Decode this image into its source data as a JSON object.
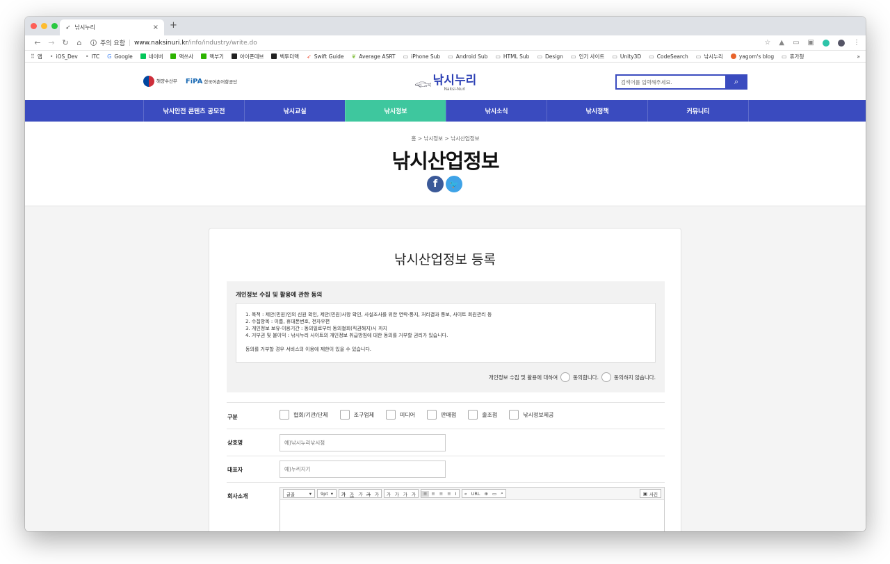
{
  "browser": {
    "tab_title": "낚시누리",
    "tab_icon": "fish-favicon",
    "new_tab_label": "+",
    "close_label": "×",
    "security_label": "주의 요함",
    "url_host": "www.naksinuri.kr",
    "url_path": "/info/industry/write.do",
    "bookmarks": [
      {
        "icon": "apps-grid-icon",
        "label": "앱"
      },
      {
        "icon": "apple-icon",
        "label": "iOS_Dev"
      },
      {
        "icon": "apple-icon",
        "label": "ITC"
      },
      {
        "icon": "google-icon",
        "label": "Google"
      },
      {
        "icon": "naver-icon",
        "label": "네이버"
      },
      {
        "icon": "green-box-icon",
        "label": "맥쓰사"
      },
      {
        "icon": "green-box-icon",
        "label": "맥부기"
      },
      {
        "icon": "black-box-icon",
        "label": "아이폰데브"
      },
      {
        "icon": "black-box-icon",
        "label": "벡투더맥"
      },
      {
        "icon": "swift-icon",
        "label": "Swift Guide"
      },
      {
        "icon": "leaf-icon",
        "label": "Average ASRT"
      },
      {
        "icon": "folder-icon",
        "label": "iPhone Sub"
      },
      {
        "icon": "folder-icon",
        "label": "Android Sub"
      },
      {
        "icon": "folder-icon",
        "label": "HTML Sub"
      },
      {
        "icon": "folder-icon",
        "label": "Design"
      },
      {
        "icon": "folder-icon",
        "label": "인기 사이트"
      },
      {
        "icon": "folder-icon",
        "label": "Unity3D"
      },
      {
        "icon": "folder-icon",
        "label": "CodeSearch"
      },
      {
        "icon": "folder-icon",
        "label": "낚시누리"
      },
      {
        "icon": "blog-icon",
        "label": "yagom's blog"
      },
      {
        "icon": "folder-icon",
        "label": "휴가청"
      }
    ],
    "bookmarks_more": "»"
  },
  "header": {
    "gov_label": "해양수산부",
    "fipa_mark": "FiPA",
    "fipa_label": "한국어촌어항공단",
    "logo_ko": "낚시누리",
    "logo_en": "Naksi-Nuri",
    "search_placeholder": "검색어를 입력해주세요."
  },
  "nav": [
    {
      "label": "낚시안전 콘텐츠 공모전",
      "active": false
    },
    {
      "label": "낚시교실",
      "active": false
    },
    {
      "label": "낚시정보",
      "active": true
    },
    {
      "label": "낚시소식",
      "active": false
    },
    {
      "label": "낚시정책",
      "active": false
    },
    {
      "label": "커뮤니티",
      "active": false
    }
  ],
  "title_area": {
    "breadcrumb": "홈 > 낚시정보 > 낚시산업정보",
    "title": "낚시산업정보",
    "facebook": "f",
    "twitter": "t"
  },
  "form": {
    "title": "낚시산업정보 등록",
    "consent": {
      "heading": "개인정보 수집 및 활용에 관한 동의",
      "lines": [
        "1. 목적 : 제안(민원)인의 신원 확인, 제안(민원)사항 확인, 사실조사를 위한 연락·통지, 처리결과 통보, 사이트 회원관리 등",
        "2. 수집항목 : 이름, 휴대폰번호, 전자우편",
        "3. 개인정보 보유·이용기간 : 동의일로부터 동의철회(직권해지)시 까지",
        "4. 거부권 및 불이익 : 낚시누리 사이트의 개인정보 취급방침에 대한 동의를 거부할 권리가 있습니다."
      ],
      "note": "동의를 거부할 경우 서비스의 이용에 제한이 있을 수 있습니다.",
      "question": "개인정보 수집 및 활용에 대하여",
      "agree": "동의합니다.",
      "disagree": "동의하지 않습니다."
    },
    "category": {
      "label": "구분",
      "options": [
        "협회/기관/단체",
        "조구업체",
        "미디어",
        "판매점",
        "출조점",
        "낚시정보제공"
      ]
    },
    "company": {
      "label": "상호명",
      "placeholder": "예)낚시누리낚시점"
    },
    "ceo": {
      "label": "대표자",
      "placeholder": "예)누리지기"
    },
    "intro": {
      "label": "회사소개",
      "font_select": "글꼴",
      "size_select": "9pt",
      "format_buttons": [
        "가",
        "가",
        "가",
        "가",
        "가"
      ],
      "color_buttons": [
        "가",
        "가",
        "가",
        "가"
      ],
      "align_buttons": [
        "≡",
        "≡",
        "≡",
        "≡",
        "I"
      ],
      "extra_buttons": [
        "«",
        "URL",
        "⊕",
        "▭",
        "⌕"
      ],
      "photo_label": "사진"
    }
  }
}
